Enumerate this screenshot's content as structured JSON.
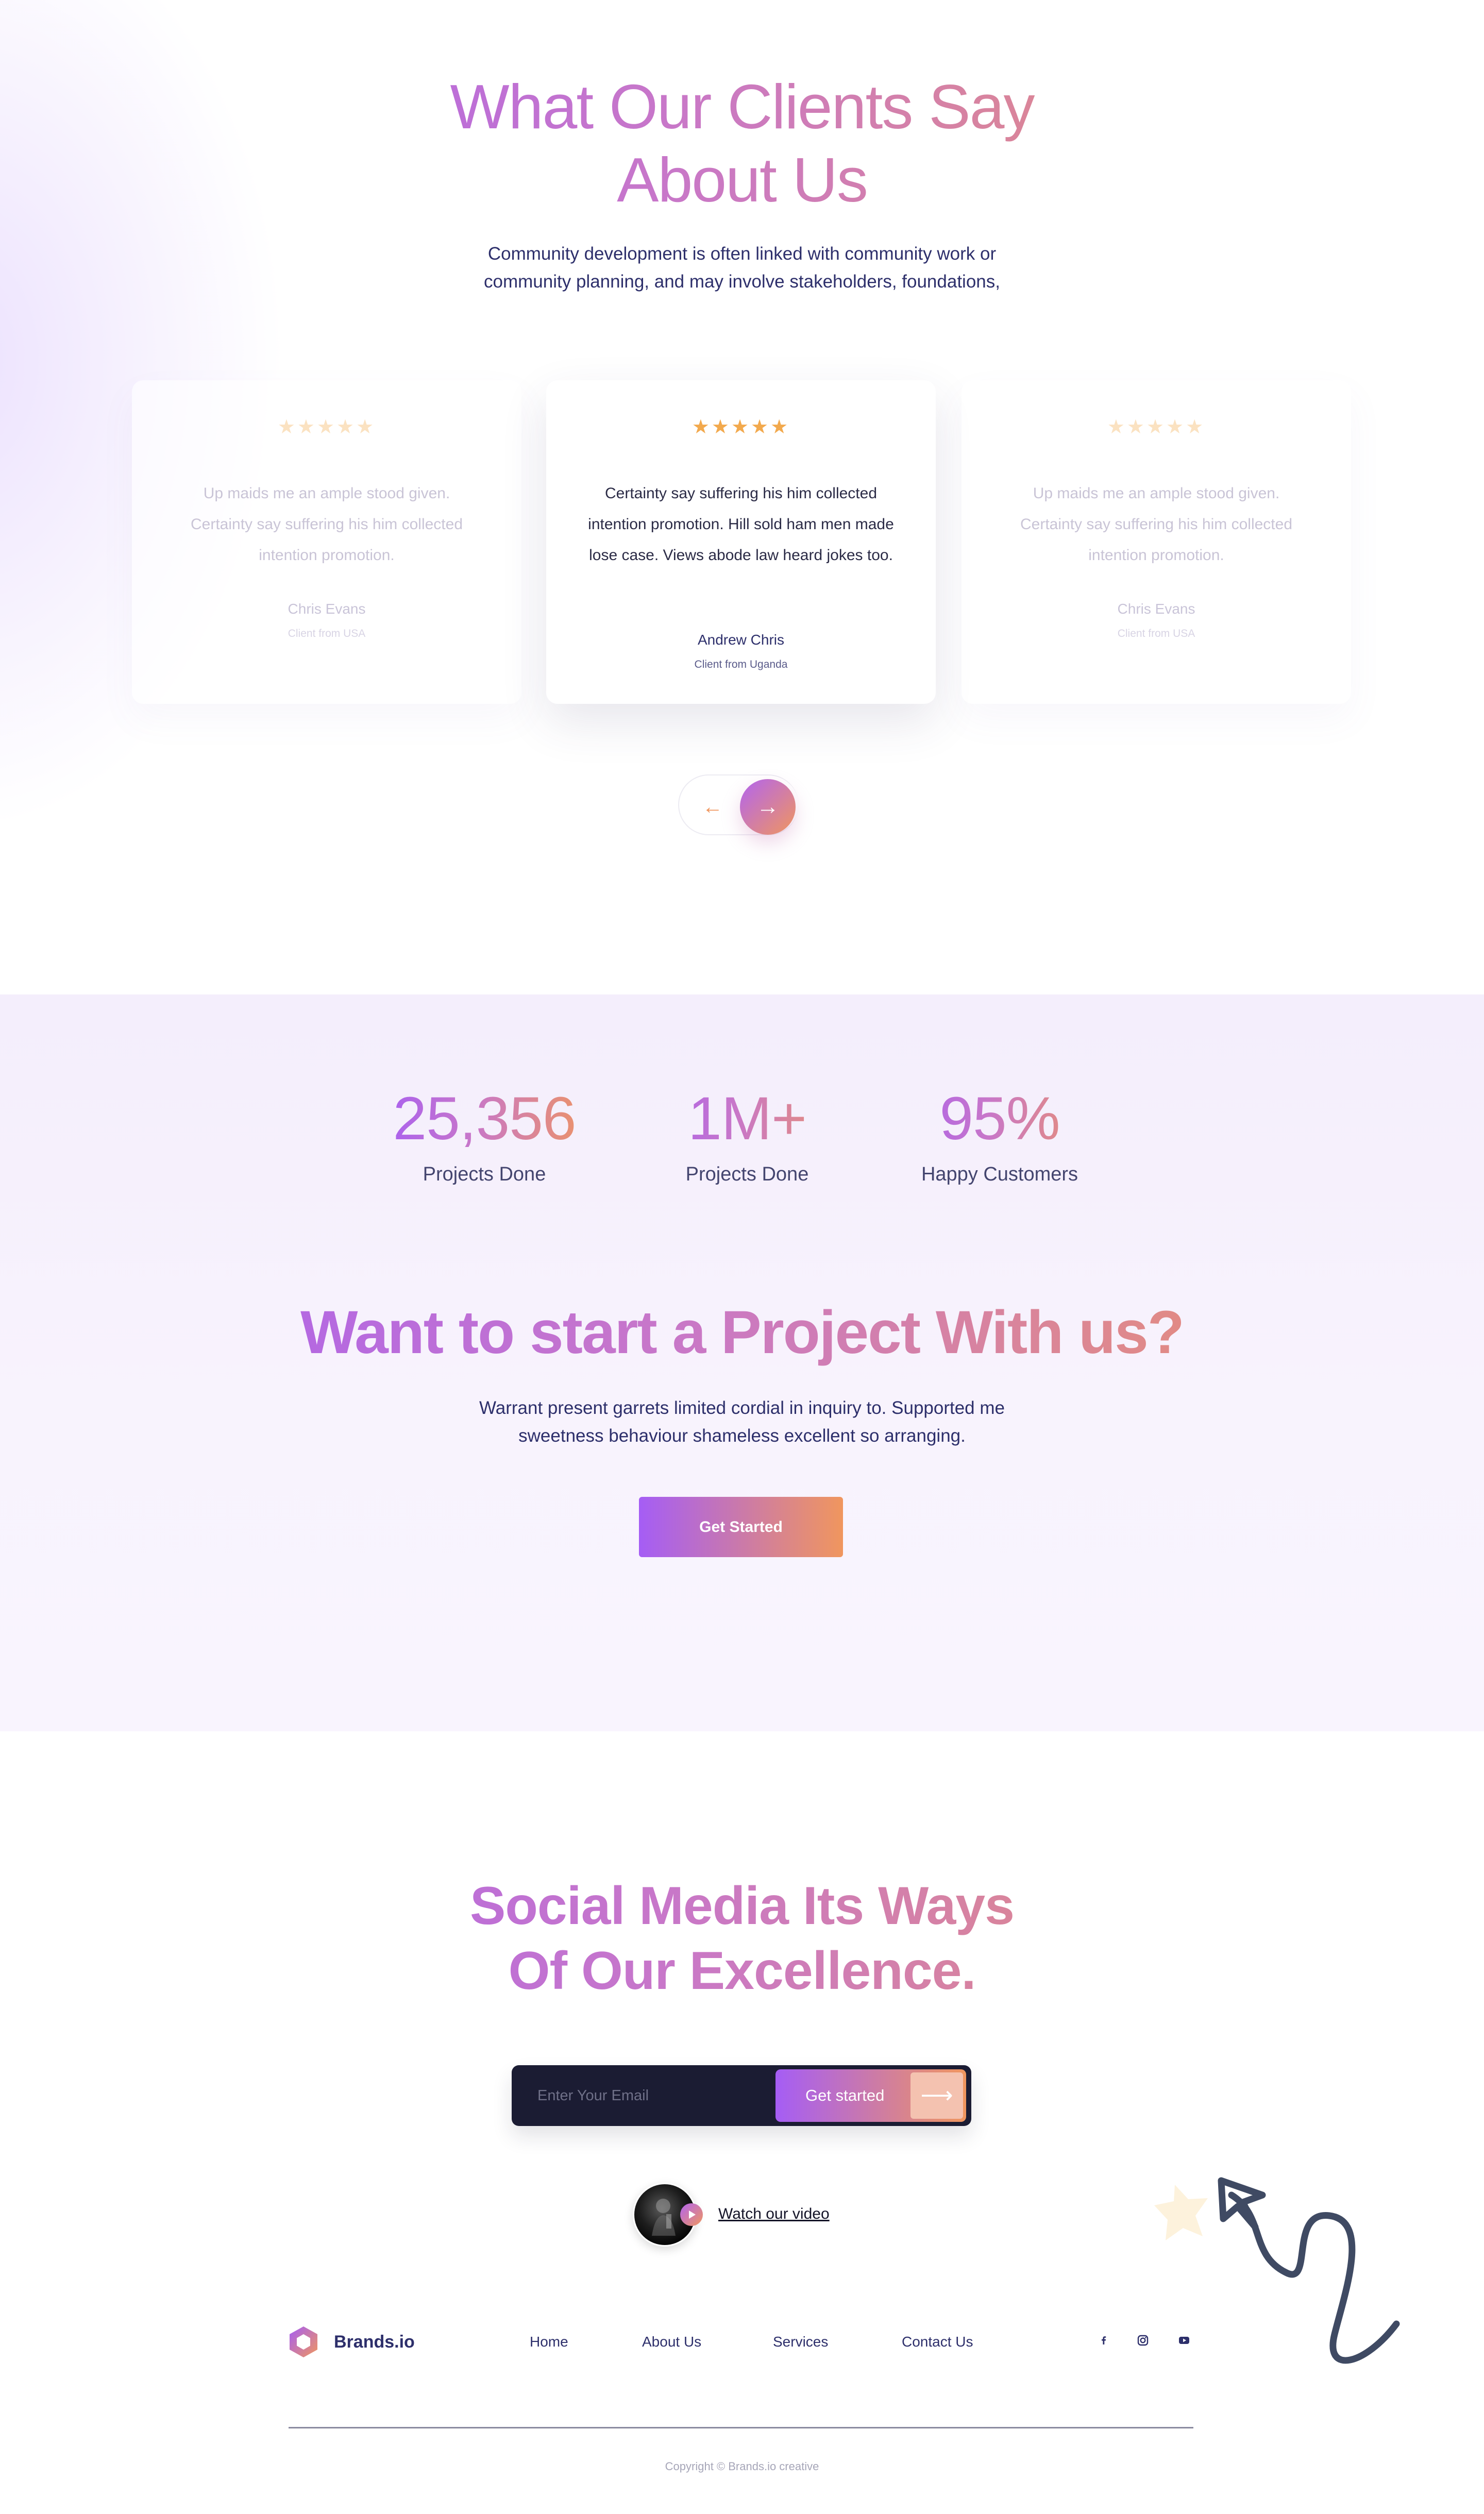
{
  "testimonials": {
    "title_line1": "What Our Clients Say",
    "title_line2": "About Us",
    "subtitle_line1": "Community development is often linked with community work or",
    "subtitle_line2": "community planning, and may involve stakeholders, foundations,",
    "cards": [
      {
        "stars": "★★★★★",
        "rating": 5,
        "quote": "Up maids me an ample stood given. Certainty say suffering his him collected intention promotion.",
        "name": "Chris Evans",
        "role": "Client from USA",
        "state": "faded"
      },
      {
        "stars": "★★★★★",
        "rating": 5,
        "quote": "Certainty say suffering his him collected intention promotion. Hill sold ham men made lose case. Views abode law heard jokes too.",
        "name": "Andrew Chris",
        "role": "Client from Uganda",
        "state": "active"
      },
      {
        "stars": "★★★★★",
        "rating": 5,
        "quote": "Up maids me an ample stood given. Certainty say suffering his him collected intention promotion.",
        "name": "Chris Evans",
        "role": "Client from USA",
        "state": "faded"
      }
    ],
    "prev_icon": "arrow-left-icon",
    "next_icon": "arrow-right-icon",
    "prev_glyph": "←",
    "next_glyph": "→"
  },
  "stats": [
    {
      "value": "25,356",
      "label": "Projects Done"
    },
    {
      "value": "1M+",
      "label": "Projects Done"
    },
    {
      "value": "95%",
      "label": "Happy Customers"
    }
  ],
  "cta": {
    "title": "Want to start a Project With us?",
    "subtitle_line1": "Warrant present garrets limited cordial in inquiry to. Supported me",
    "subtitle_line2": "sweetness behaviour shameless excellent so arranging.",
    "button_label": "Get Started"
  },
  "social": {
    "title_line1": "Social Media Its Ways",
    "title_line2": "Of Our Excellence.",
    "email_placeholder": "Enter Your Email",
    "submit_label": "Get started",
    "submit_glyph": "⟶",
    "video_label": "Watch our video"
  },
  "footer": {
    "brand": "Brands.io",
    "nav": [
      "Home",
      "About Us",
      "Services",
      "Contact Us"
    ],
    "social_icons": [
      "facebook-icon",
      "instagram-icon",
      "youtube-icon"
    ],
    "copyright": "Copyright © Brands.io creative"
  },
  "colors": {
    "gradient_start": "#a55df5",
    "gradient_end": "#f0965e",
    "navy": "#2d2f6b",
    "star": "#f2a94d",
    "input_bg": "#1b1c33",
    "section_bg": "#f6f0fd"
  }
}
